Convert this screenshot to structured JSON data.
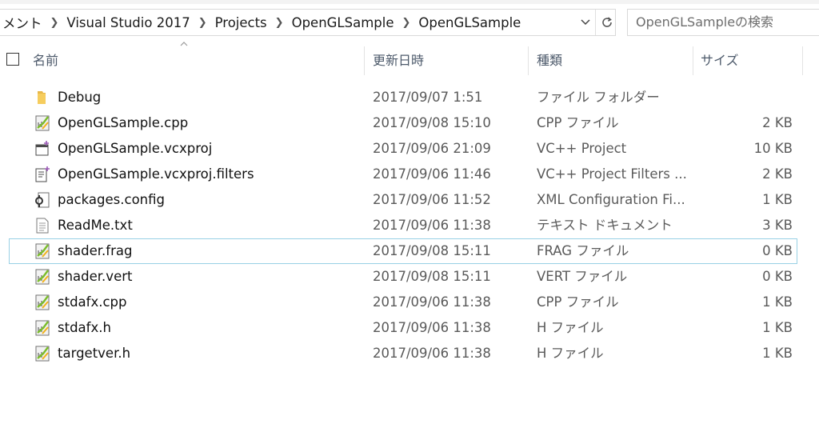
{
  "address": {
    "crumbs": [
      "メント",
      "Visual Studio 2017",
      "Projects",
      "OpenGLSample",
      "OpenGLSample"
    ],
    "dropdown_icon": "chevron-down-icon",
    "refresh_icon": "refresh-icon"
  },
  "search": {
    "placeholder": "OpenGLSampleの検索"
  },
  "columns": {
    "name": "名前",
    "date": "更新日時",
    "type": "種類",
    "size": "サイズ"
  },
  "files": [
    {
      "name": "Debug",
      "date": "2017/09/07 1:51",
      "type": "ファイル フォルダー",
      "size": "",
      "icon": "folder-icon"
    },
    {
      "name": "OpenGLSample.cpp",
      "date": "2017/09/08 15:10",
      "type": "CPP ファイル",
      "size": "2 KB",
      "icon": "source-file-icon"
    },
    {
      "name": "OpenGLSample.vcxproj",
      "date": "2017/09/06 21:09",
      "type": "VC++ Project",
      "size": "10 KB",
      "icon": "project-file-icon"
    },
    {
      "name": "OpenGLSample.vcxproj.filters",
      "date": "2017/09/06 11:46",
      "type": "VC++ Project Filters ...",
      "size": "2 KB",
      "icon": "filters-file-icon"
    },
    {
      "name": "packages.config",
      "date": "2017/09/06 11:52",
      "type": "XML Configuration Fi...",
      "size": "1 KB",
      "icon": "config-file-icon"
    },
    {
      "name": "ReadMe.txt",
      "date": "2017/09/06 11:38",
      "type": "テキスト ドキュメント",
      "size": "3 KB",
      "icon": "text-file-icon"
    },
    {
      "name": "shader.frag",
      "date": "2017/09/08 15:11",
      "type": "FRAG ファイル",
      "size": "0 KB",
      "icon": "source-file-icon"
    },
    {
      "name": "shader.vert",
      "date": "2017/09/08 15:11",
      "type": "VERT ファイル",
      "size": "0 KB",
      "icon": "source-file-icon"
    },
    {
      "name": "stdafx.cpp",
      "date": "2017/09/06 11:38",
      "type": "CPP ファイル",
      "size": "1 KB",
      "icon": "source-file-icon"
    },
    {
      "name": "stdafx.h",
      "date": "2017/09/06 11:38",
      "type": "H ファイル",
      "size": "1 KB",
      "icon": "source-file-icon"
    },
    {
      "name": "targetver.h",
      "date": "2017/09/06 11:38",
      "type": "H ファイル",
      "size": "1 KB",
      "icon": "source-file-icon"
    }
  ],
  "focused_file": "shader.frag"
}
